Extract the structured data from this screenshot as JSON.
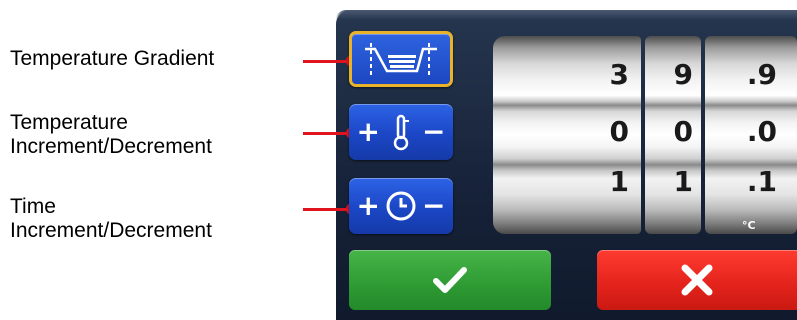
{
  "annotations": [
    {
      "lines": [
        "Temperature Gradient"
      ]
    },
    {
      "lines": [
        "Temperature",
        "Increment/Decrement"
      ]
    },
    {
      "lines": [
        "Time",
        "Increment/Decrement"
      ]
    }
  ],
  "mode_buttons": {
    "gradient": {
      "icon": "gradient-block-icon",
      "selected": true
    },
    "temperature": {
      "plus": "+",
      "minus": "−",
      "icon": "thermometer-icon"
    },
    "time": {
      "plus": "+",
      "minus": "−",
      "icon": "clock-icon"
    }
  },
  "drums": {
    "rows": [
      {
        "d1": "3",
        "d2": "9",
        "d3": ".9"
      },
      {
        "d1": "0",
        "d2": "0",
        "d3": ".0"
      },
      {
        "d1": "1",
        "d2": "1",
        "d3": ".1"
      }
    ],
    "unit": "°C"
  },
  "actions": {
    "confirm_icon": "checkmark-icon",
    "cancel_icon": "x-icon"
  },
  "colors": {
    "leader": "#e0141e",
    "selected_border": "#e8b22a",
    "mode_button": "#1b46c5",
    "confirm": "#2e9a33",
    "cancel": "#e2231b"
  }
}
